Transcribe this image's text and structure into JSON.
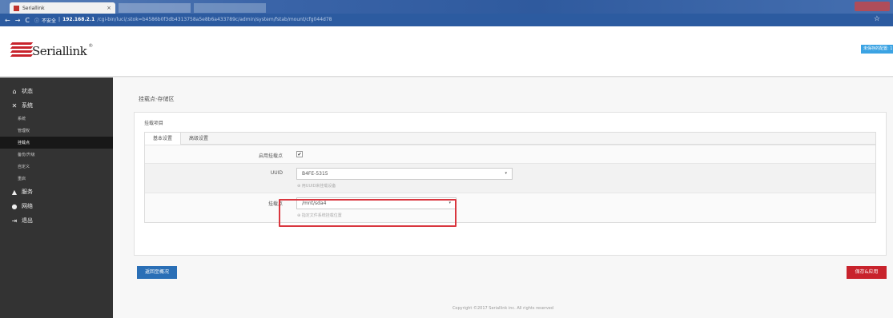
{
  "browser": {
    "tab_title": "Seriallink",
    "tab_close": "×",
    "insecure_label": "不安全",
    "host": "192.168.2.1",
    "path": "/cgi-bin/luci/;stok=b4586b0f3db4313758a5e8b6a433789c/admin/system/fstab/mount/cfg044d78",
    "back_glyph": "←",
    "forward_glyph": "→",
    "reload_glyph": "C",
    "info_glyph": "ⓘ",
    "star_glyph": "☆"
  },
  "header": {
    "logo_text": "Seriallink",
    "logo_reg": "®",
    "unsaved_label": "未保存的配置: 1"
  },
  "sidebar": {
    "items": [
      {
        "label": "状态",
        "icon": "home-icon",
        "glyph": "⌂"
      },
      {
        "label": "系统",
        "icon": "tools-icon",
        "glyph": "✕"
      },
      {
        "label": "服务",
        "icon": "service-icon",
        "glyph": "▲"
      },
      {
        "label": "网络",
        "icon": "network-icon",
        "glyph": "●"
      },
      {
        "label": "退出",
        "icon": "logout-icon",
        "glyph": "⇥"
      }
    ],
    "subitems": [
      {
        "label": "系统"
      },
      {
        "label": "管理权"
      },
      {
        "label": "挂载点"
      },
      {
        "label": "备份/升级"
      },
      {
        "label": "自定义"
      },
      {
        "label": "重启"
      }
    ],
    "active_subitem": "挂载点"
  },
  "main": {
    "page_title": "挂载点-存储区",
    "section_title": "挂载项目",
    "tabs": [
      {
        "label": "基本设置",
        "active": true
      },
      {
        "label": "高级设置",
        "active": false
      }
    ],
    "fields": {
      "enable_label": "启用挂载点",
      "enable_checked": "✔",
      "uuid_label": "UUID",
      "uuid_value": "B4FE-5315",
      "uuid_hint": "⊕ 用UUID来挂载设备",
      "mount_label": "挂载点",
      "mount_value": "/mnt/sda4",
      "mount_hint": "⊕ 指定文件系统挂载位置",
      "caret": "▾"
    },
    "back_button": "返回至概况",
    "save_button": "保存&应用",
    "footer": "Copyright ©2017 Seriallink inc. All rights reserved"
  },
  "colors": {
    "accent_red": "#c8232c",
    "accent_blue": "#2a6fb6",
    "sidebar_bg": "#333333",
    "highlight_red": "#d9363e"
  }
}
